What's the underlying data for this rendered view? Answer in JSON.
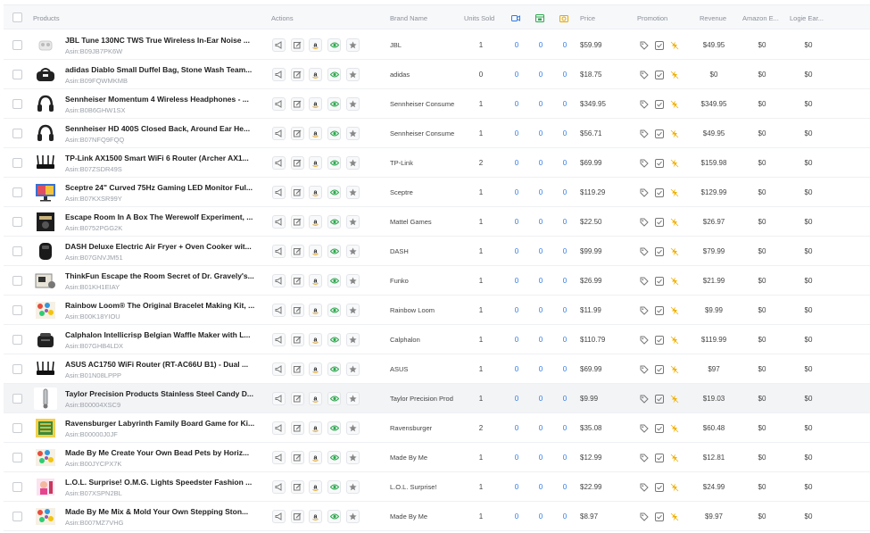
{
  "header": {
    "products": "Products",
    "actions": "Actions",
    "brand": "Brand Name",
    "units": "Units Sold",
    "price": "Price",
    "promotion": "Promotion",
    "revenue": "Revenue",
    "amazon": "Amazon E...",
    "logie": "Logie Ear..."
  },
  "header_icons": [
    "video-icon",
    "calendar-icon",
    "camera-icon"
  ],
  "colors": {
    "blue_value": "#2f7be5",
    "bolt": "#f0b000",
    "eye": "#2fa84f",
    "border": "#eef0f3"
  },
  "rows": [
    {
      "name": "JBL Tune 130NC TWS True Wireless In-Ear Noise ...",
      "asin": "Asin:B09JB7PK6W",
      "brand": "JBL",
      "units": "1",
      "c1": "0",
      "c2": "0",
      "c3": "0",
      "price": "$59.99",
      "revenue": "$49.95",
      "amazon": "$0",
      "logie": "$0",
      "thumb": "earbuds"
    },
    {
      "name": "adidas Diablo Small Duffel Bag, Stone Wash Team...",
      "asin": "Asin:B09FQWMKMB",
      "brand": "adidas",
      "units": "0",
      "c1": "0",
      "c2": "0",
      "c3": "0",
      "price": "$18.75",
      "revenue": "$0",
      "amazon": "$0",
      "logie": "$0",
      "thumb": "bag"
    },
    {
      "name": "Sennheiser Momentum 4 Wireless Headphones - ...",
      "asin": "Asin:B0B6GHW1SX",
      "brand": "Sennheiser Consume",
      "units": "1",
      "c1": "0",
      "c2": "0",
      "c3": "0",
      "price": "$349.95",
      "revenue": "$349.95",
      "amazon": "$0",
      "logie": "$0",
      "thumb": "headphones"
    },
    {
      "name": "Sennheiser HD 400S Closed Back, Around Ear He...",
      "asin": "Asin:B07NFQ9FQQ",
      "brand": "Sennheiser Consume",
      "units": "1",
      "c1": "0",
      "c2": "0",
      "c3": "0",
      "price": "$56.71",
      "revenue": "$49.95",
      "amazon": "$0",
      "logie": "$0",
      "thumb": "headphones"
    },
    {
      "name": "TP-Link AX1500 Smart WiFi 6 Router (Archer AX1...",
      "asin": "Asin:B07ZSDR49S",
      "brand": "TP-Link",
      "units": "2",
      "c1": "0",
      "c2": "0",
      "c3": "0",
      "price": "$69.99",
      "revenue": "$159.98",
      "amazon": "$0",
      "logie": "$0",
      "thumb": "router"
    },
    {
      "name": "Sceptre 24\" Curved 75Hz Gaming LED Monitor Ful...",
      "asin": "Asin:B07KXSR99Y",
      "brand": "Sceptre",
      "units": "1",
      "c1": "0",
      "c2": "0",
      "c3": "0",
      "price": "$119.29",
      "revenue": "$129.99",
      "amazon": "$0",
      "logie": "$0",
      "thumb": "monitor"
    },
    {
      "name": "Escape Room In A Box The Werewolf Experiment, ...",
      "asin": "Asin:B0752PGG2K",
      "brand": "Mattel Games",
      "units": "1",
      "c1": "0",
      "c2": "0",
      "c3": "0",
      "price": "$22.50",
      "revenue": "$26.97",
      "amazon": "$0",
      "logie": "$0",
      "thumb": "box-dark"
    },
    {
      "name": "DASH Deluxe Electric Air Fryer + Oven Cooker wit...",
      "asin": "Asin:B07GNVJM51",
      "brand": "DASH",
      "units": "1",
      "c1": "0",
      "c2": "0",
      "c3": "0",
      "price": "$99.99",
      "revenue": "$79.99",
      "amazon": "$0",
      "logie": "$0",
      "thumb": "fryer"
    },
    {
      "name": "ThinkFun Escape the Room Secret of Dr. Gravely's...",
      "asin": "Asin:B01KH1EIAY",
      "brand": "Funko",
      "units": "1",
      "c1": "0",
      "c2": "0",
      "c3": "0",
      "price": "$26.99",
      "revenue": "$21.99",
      "amazon": "$0",
      "logie": "$0",
      "thumb": "game"
    },
    {
      "name": "Rainbow Loom® The Original Bracelet Making Kit, ...",
      "asin": "Asin:B00K18YIOU",
      "brand": "Rainbow Loom",
      "units": "1",
      "c1": "0",
      "c2": "0",
      "c3": "0",
      "price": "$11.99",
      "revenue": "$9.99",
      "amazon": "$0",
      "logie": "$0",
      "thumb": "colorful"
    },
    {
      "name": "Calphalon Intellicrisp Belgian Waffle Maker with L...",
      "asin": "Asin:B07GHB4LDX",
      "brand": "Calphalon",
      "units": "1",
      "c1": "0",
      "c2": "0",
      "c3": "0",
      "price": "$110.79",
      "revenue": "$119.99",
      "amazon": "$0",
      "logie": "$0",
      "thumb": "appliance"
    },
    {
      "name": "ASUS AC1750 WiFi Router (RT-AC66U B1) - Dual ...",
      "asin": "Asin:B01N08LPPP",
      "brand": "ASUS",
      "units": "1",
      "c1": "0",
      "c2": "0",
      "c3": "0",
      "price": "$69.99",
      "revenue": "$97",
      "amazon": "$0",
      "logie": "$0",
      "thumb": "router"
    },
    {
      "name": "Taylor Precision Products Stainless Steel Candy D...",
      "asin": "Asin:B00004XSC9",
      "brand": "Taylor Precision Prod",
      "units": "1",
      "c1": "0",
      "c2": "0",
      "c3": "0",
      "price": "$9.99",
      "revenue": "$19.03",
      "amazon": "$0",
      "logie": "$0",
      "thumb": "thermometer",
      "highlight": true
    },
    {
      "name": "Ravensburger Labyrinth Family Board Game for Ki...",
      "asin": "Asin:B00000J0JF",
      "brand": "Ravensburger",
      "units": "2",
      "c1": "0",
      "c2": "0",
      "c3": "0",
      "price": "$35.08",
      "revenue": "$60.48",
      "amazon": "$0",
      "logie": "$0",
      "thumb": "board"
    },
    {
      "name": "Made By Me Create Your Own Bead Pets by Horiz...",
      "asin": "Asin:B00JYCPX7K",
      "brand": "Made By Me",
      "units": "1",
      "c1": "0",
      "c2": "0",
      "c3": "0",
      "price": "$12.99",
      "revenue": "$12.81",
      "amazon": "$0",
      "logie": "$0",
      "thumb": "colorful"
    },
    {
      "name": "L.O.L. Surprise! O.M.G. Lights Speedster Fashion ...",
      "asin": "Asin:B07XSPN2BL",
      "brand": "L.O.L. Surprise!",
      "units": "1",
      "c1": "0",
      "c2": "0",
      "c3": "0",
      "price": "$22.99",
      "revenue": "$24.99",
      "amazon": "$0",
      "logie": "$0",
      "thumb": "doll"
    },
    {
      "name": "Made By Me Mix & Mold Your Own Stepping Ston...",
      "asin": "Asin:B007MZ7VHG",
      "brand": "Made By Me",
      "units": "1",
      "c1": "0",
      "c2": "0",
      "c3": "0",
      "price": "$8.97",
      "revenue": "$9.97",
      "amazon": "$0",
      "logie": "$0",
      "thumb": "colorful"
    }
  ]
}
